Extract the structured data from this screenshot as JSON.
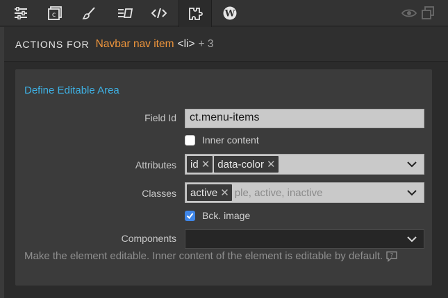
{
  "toolbar": {
    "icons": [
      "sliders-icon",
      "component-icon",
      "brush-icon",
      "layout-icon",
      "code-icon",
      "puzzle-icon",
      "wordpress-icon"
    ],
    "active": "puzzle-icon",
    "right_icons": [
      "eye-icon",
      "duplicate-icon"
    ]
  },
  "header": {
    "label": "ACTIONS FOR",
    "element_name": "Navbar nav item",
    "element_tag": "<li>",
    "extra_count": "+ 3"
  },
  "panel": {
    "title": "Define Editable Area",
    "field_id": {
      "label": "Field Id",
      "value": "ct.menu-items"
    },
    "inner_content": {
      "label": "Inner content",
      "checked": false
    },
    "attributes": {
      "label": "Attributes",
      "chips": [
        "id",
        "data-color"
      ]
    },
    "classes": {
      "label": "Classes",
      "chips": [
        "active"
      ],
      "placeholder": "ple, active, inactive"
    },
    "bck_image": {
      "label": "Bck. image",
      "checked": true
    },
    "components": {
      "label": "Components",
      "value": ""
    },
    "description": "Make the element editable. Inner content of the element is editable by default."
  },
  "colors": {
    "accent_orange": "#f0963c",
    "accent_blue": "#3eb0e3",
    "checkbox_blue": "#3f86e8"
  }
}
